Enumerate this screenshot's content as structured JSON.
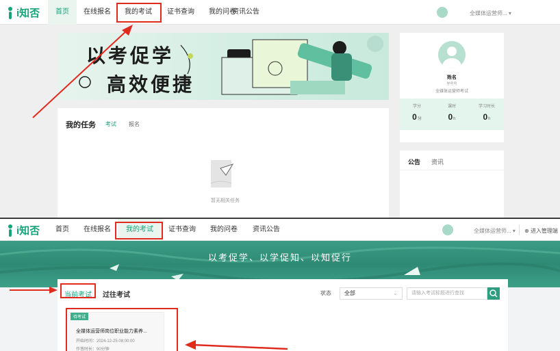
{
  "logo": {
    "text": "i知否"
  },
  "top": {
    "nav": [
      "首页",
      "在线报名",
      "我的考试",
      "证书查询",
      "我的问卷",
      "资讯公告"
    ],
    "user_name": "全媒体运营师...",
    "banner": {
      "line1": "以考促学",
      "line2": "高效便捷"
    },
    "task": {
      "title": "我的任务",
      "tabs": [
        "考试",
        "报名"
      ],
      "empty_text": "暂无相关任务"
    },
    "profile": {
      "name": "姓名",
      "id_label": "学号号",
      "org": "全媒体运营师考试",
      "stats": [
        {
          "label": "学分",
          "value": "0",
          "unit": "分"
        },
        {
          "label": "课时",
          "value": "0",
          "unit": "h"
        },
        {
          "label": "学习时长",
          "value": "0",
          "unit": "h"
        }
      ]
    },
    "notice_tabs": [
      "公告",
      "资讯"
    ]
  },
  "bottom": {
    "nav": [
      "首页",
      "在线报名",
      "我的考试",
      "证书查询",
      "我的问卷",
      "资讯公告"
    ],
    "user_name": "全媒体运营师...",
    "admin_link": "进入管理端",
    "hero_text": "以考促学、以学促知、以知促行",
    "tabs": [
      "当前考试",
      "过往考试"
    ],
    "status_label": "状态",
    "status_value": "全部",
    "search_placeholder": "请输入考试标题进行查找",
    "exam": {
      "badge": "待考试",
      "title": "全媒体运营师岗位职业能力素养...",
      "start": "开始时间：2024-12-25 08:00:00",
      "duration": "作答时长：90分钟"
    }
  },
  "colors": {
    "accent": "#17a37a",
    "highlight": "#e02a1e"
  }
}
